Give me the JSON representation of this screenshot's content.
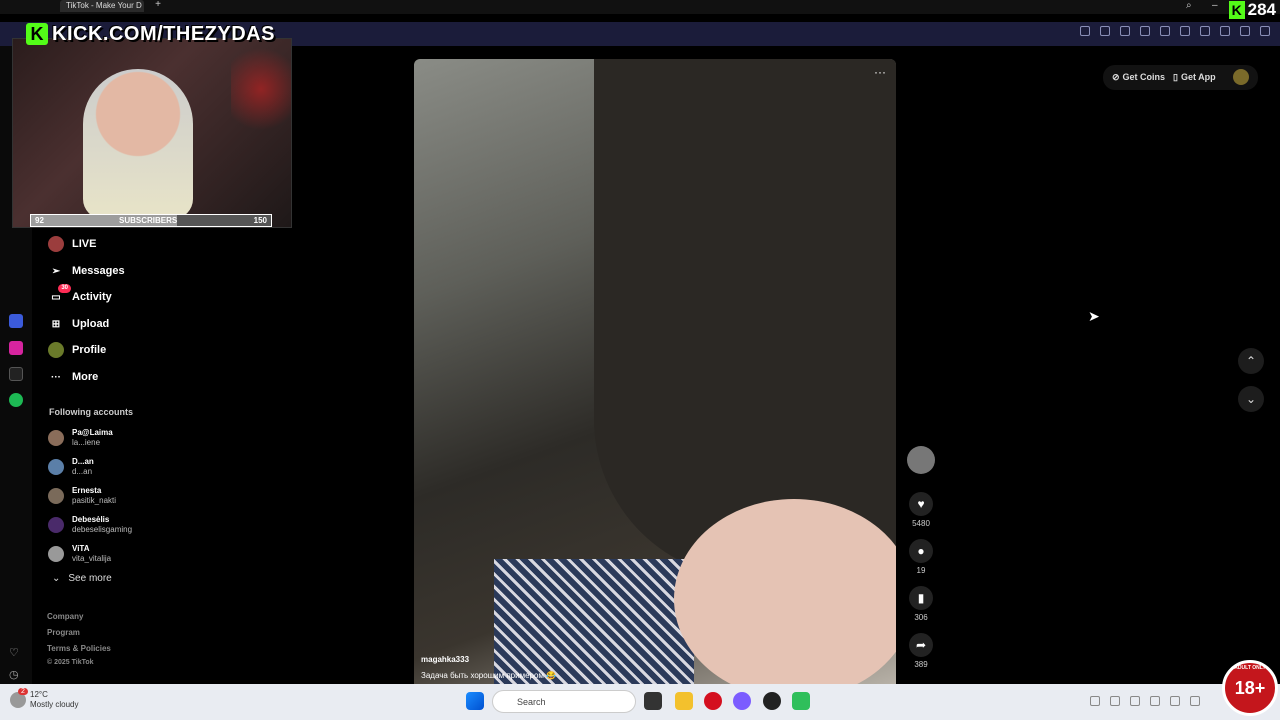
{
  "browser": {
    "tab_title": "TikTok - Make Your D",
    "new_tab": "+"
  },
  "stream_overlay": {
    "kick_url": "KICK.COM/THEZYDAS",
    "kick_logo_letter": "K",
    "viewer_count": "284",
    "subs_current": "92",
    "subs_label": "SUBSCRIBERS",
    "subs_goal": "150",
    "subs_progress": 0.61
  },
  "sidebar": {
    "nav": [
      {
        "label": "LIVE",
        "badge": ""
      },
      {
        "label": "Messages",
        "badge": ""
      },
      {
        "label": "Activity",
        "badge": "30"
      },
      {
        "label": "Upload",
        "badge": ""
      },
      {
        "label": "Profile",
        "badge": ""
      },
      {
        "label": "More",
        "badge": ""
      }
    ],
    "following_title": "Following accounts",
    "accounts": [
      {
        "name": "Pa@Laima",
        "handle": "la...iene"
      },
      {
        "name": "D...an",
        "handle": "d...an"
      },
      {
        "name": "Ernesta",
        "handle": "pasitik_nakti"
      },
      {
        "name": "Debesėlis",
        "handle": "debeselisgaming"
      },
      {
        "name": "ViTA",
        "handle": "vita_vitalija"
      }
    ],
    "see_more": "See more",
    "footer": [
      "Company",
      "Program",
      "Terms & Policies",
      "© 2025 TikTok"
    ]
  },
  "header": {
    "get_coins": "Get Coins",
    "get_app": "Get App"
  },
  "video": {
    "more": "···",
    "username": "magahka333",
    "description": "Задача быть хорошим примером 😂"
  },
  "actions": {
    "likes": "5480",
    "comments": "19",
    "saves": "306",
    "shares": "389"
  },
  "taskbar": {
    "temp": "12°C",
    "weather": "Mostly cloudy",
    "search_placeholder": "Search",
    "notification_count": "2"
  },
  "adult_badge": {
    "label": "18+",
    "ring_text": "ADULT ONLY"
  },
  "colors": {
    "kick_green": "#53fc18",
    "tiktok_red": "#fe2c55",
    "browser_toolbar": "#1b1c3a"
  }
}
